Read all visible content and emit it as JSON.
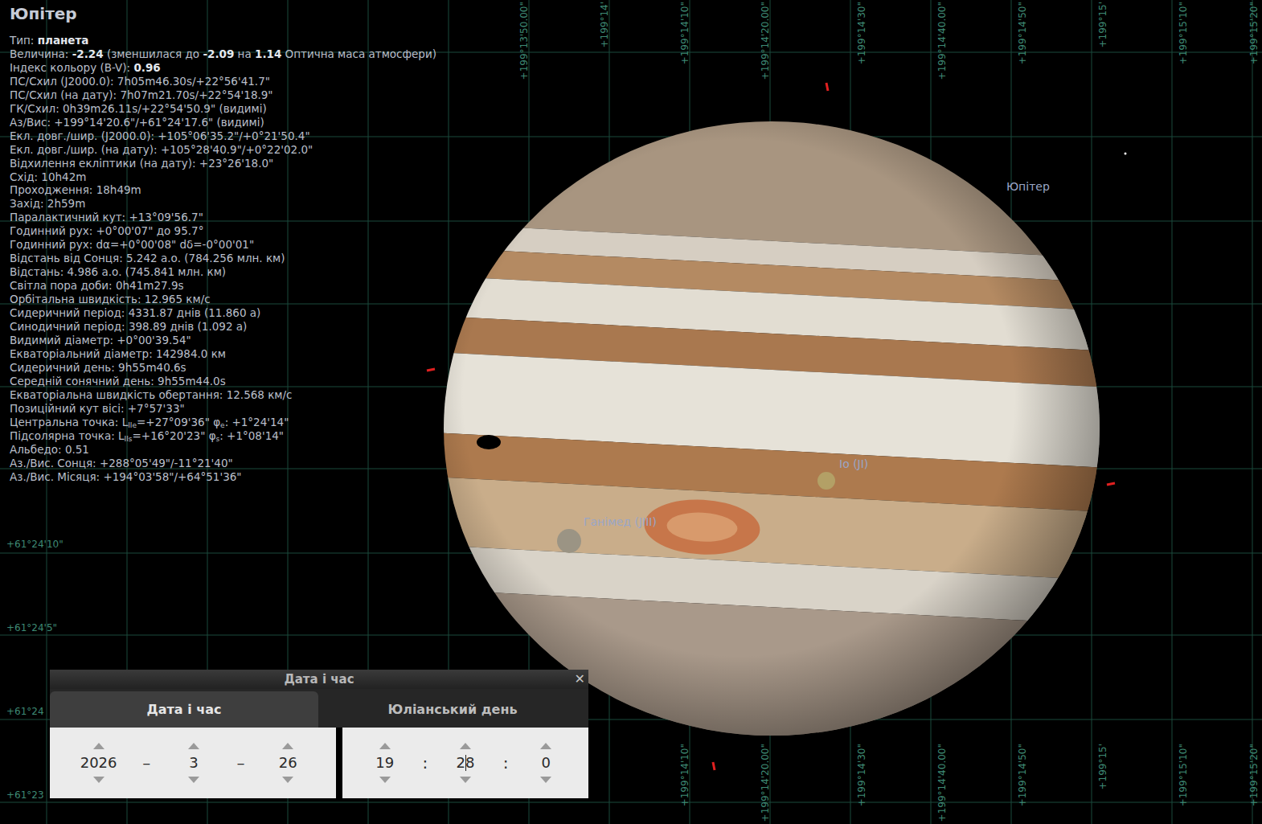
{
  "info": {
    "title": "Юпітер",
    "lines": [
      [
        {
          "t": "Тип: ",
          "s": "normal"
        },
        {
          "t": "планета",
          "s": "bold"
        }
      ],
      [
        {
          "t": "Величина: ",
          "s": "normal"
        },
        {
          "t": "-2.24",
          "s": "bold"
        },
        {
          "t": " (зменшилася до ",
          "s": "normal"
        },
        {
          "t": "-2.09",
          "s": "bold"
        },
        {
          "t": " на ",
          "s": "normal"
        },
        {
          "t": "1.14",
          "s": "bold"
        },
        {
          "t": " Оптична маса атмосфери)",
          "s": "normal"
        }
      ],
      [
        {
          "t": "Індекс кольору (B-V): ",
          "s": "normal"
        },
        {
          "t": "0.96",
          "s": "bold"
        }
      ],
      [
        {
          "t": "ПС/Схил (J2000.0): 7h05m46.30s/+22°56'41.7\"",
          "s": "normal"
        }
      ],
      [
        {
          "t": "ПС/Схил (на дату): 7h07m21.70s/+22°54'18.9\"",
          "s": "normal"
        }
      ],
      [
        {
          "t": "ГК/Схил: 0h39m26.11s/+22°54'50.9\" (видимі)",
          "s": "normal"
        }
      ],
      [
        {
          "t": "Аз/Вис: +199°14'20.6\"/+61°24'17.6\" (видимі)",
          "s": "normal"
        }
      ],
      [
        {
          "t": "Екл. довг./шир. (J2000.0): +105°06'35.2\"/+0°21'50.4\"",
          "s": "normal"
        }
      ],
      [
        {
          "t": "Екл. довг./шир. (на дату): +105°28'40.9\"/+0°22'02.0\"",
          "s": "normal"
        }
      ],
      [
        {
          "t": "Відхилення екліптики (на дату): +23°26'18.0\"",
          "s": "normal"
        }
      ],
      [
        {
          "t": "Схід: 10h42m",
          "s": "normal"
        }
      ],
      [
        {
          "t": "Проходження: 18h49m",
          "s": "normal"
        }
      ],
      [
        {
          "t": "Захід: 2h59m",
          "s": "normal"
        }
      ],
      [
        {
          "t": "Паралактичний кут: +13°09'56.7\"",
          "s": "normal"
        }
      ],
      [
        {
          "t": "Годинний рух: +0°00'07\" до 95.7°",
          "s": "normal"
        }
      ],
      [
        {
          "t": "Годинний рух: dα=+0°00'08\" dδ=-0°00'01\"",
          "s": "normal"
        }
      ],
      [
        {
          "t": "Відстань від Сонця: 5.242 а.о. (784.256 млн. км)",
          "s": "normal"
        }
      ],
      [
        {
          "t": "Відстань: 4.986 а.о. (745.841 млн. км)",
          "s": "normal"
        }
      ],
      [
        {
          "t": "Світла пора доби: 0h41m27.9s",
          "s": "normal"
        }
      ],
      [
        {
          "t": "Орбітальна швидкість: 12.965 км/с",
          "s": "normal"
        }
      ],
      [
        {
          "t": "Сидеричний період: 4331.87 днів (11.860 а)",
          "s": "normal"
        }
      ],
      [
        {
          "t": "Синодичний період: 398.89 днів (1.092 а)",
          "s": "normal"
        }
      ],
      [
        {
          "t": "Видимий діаметр: +0°00'39.54\"",
          "s": "normal"
        }
      ],
      [
        {
          "t": "Екваторіальний діаметр: 142984.0 км",
          "s": "normal"
        }
      ],
      [
        {
          "t": "Сидеричний день: 9h55m40.6s",
          "s": "normal"
        }
      ],
      [
        {
          "t": "Середній сонячний день: 9h55m44.0s",
          "s": "normal"
        }
      ],
      [
        {
          "t": "Екваторіальна швидкість обертання: 12.568 км/с",
          "s": "normal"
        }
      ],
      [
        {
          "t": "Позиційний кут вісі: +7°57'33\"",
          "s": "normal"
        }
      ],
      [
        {
          "t": "Центральна точка: L",
          "s": "normal"
        },
        {
          "t": "IIe",
          "s": "sub"
        },
        {
          "t": "=+27°09'36\" φ",
          "s": "normal"
        },
        {
          "t": "e",
          "s": "sub"
        },
        {
          "t": ": +1°24'14\"",
          "s": "normal"
        }
      ],
      [
        {
          "t": "Підсолярна точка: L",
          "s": "normal"
        },
        {
          "t": "IIs",
          "s": "sub"
        },
        {
          "t": "=+16°20'23\" φ",
          "s": "normal"
        },
        {
          "t": "s",
          "s": "sub"
        },
        {
          "t": ": +1°08'14\"",
          "s": "normal"
        }
      ],
      [
        {
          "t": "Альбедо: 0.51",
          "s": "normal"
        }
      ],
      [
        {
          "t": "Аз./Вис. Сонця: +288°05'49\"/-11°21'40\"",
          "s": "normal"
        }
      ],
      [
        {
          "t": "Аз./Вис. Місяця: +194°03'58\"/+64°51'36\"",
          "s": "normal"
        }
      ]
    ]
  },
  "grid": {
    "top_labels": [
      "+199°13'50.00\"",
      "+199°14'",
      "+199°14'10\"",
      "+199°14'20.00\"",
      "+199°14'30\"",
      "+199°14'40.00\"",
      "+199°14'50\"",
      "+199°15'",
      "+199°15'10\"",
      "+199°15'20\""
    ],
    "bottom_labels": [
      "+199°14'10\"",
      "+199°14'20.00\"",
      "+199°14'30\"",
      "+199°14'40.00\"",
      "+199°14'50\"",
      "+199°15'",
      "+199°15'10\"",
      "+199°15'20\""
    ],
    "left_labels": [
      "+61°24'10\"",
      "+61°24'5\"",
      "+61°24",
      "+61°23"
    ]
  },
  "planet": {
    "name": "Юпітер"
  },
  "moons": [
    {
      "name": "Io (JI)"
    },
    {
      "name": "Ганімед (JIII)"
    }
  ],
  "dialog": {
    "title": "Дата і час",
    "close": "✕",
    "tabs": [
      {
        "label": "Дата і час",
        "selected": true
      },
      {
        "label": "Юліанський день",
        "selected": false
      }
    ],
    "date_fields": [
      {
        "value": "2026",
        "focused": false
      },
      {
        "value": "3",
        "focused": false
      },
      {
        "value": "26",
        "focused": false
      }
    ],
    "date_separator": "–",
    "time_fields": [
      {
        "value": "19",
        "focused": false
      },
      {
        "value": "28",
        "focused": true
      },
      {
        "value": "0",
        "focused": false
      }
    ],
    "time_separator": ":"
  }
}
